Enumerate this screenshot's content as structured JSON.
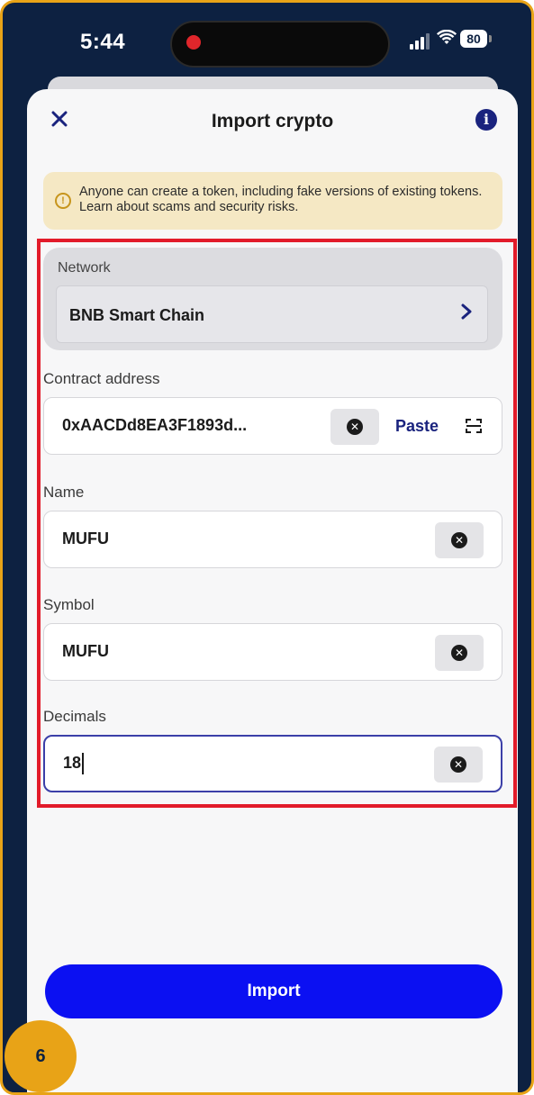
{
  "status_bar": {
    "time": "5:44",
    "battery": "80"
  },
  "header": {
    "title": "Import crypto"
  },
  "warning": {
    "text": "Anyone can create a token, including fake versions of existing tokens. Learn about scams and security risks."
  },
  "network": {
    "label": "Network",
    "value": "BNB Smart Chain"
  },
  "contract": {
    "label": "Contract address",
    "value": "0xAACDd8EA3F1893d...",
    "paste_label": "Paste"
  },
  "name_field": {
    "label": "Name",
    "value": "MUFU"
  },
  "symbol_field": {
    "label": "Symbol",
    "value": "MUFU"
  },
  "decimals_field": {
    "label": "Decimals",
    "value": "18"
  },
  "actions": {
    "import_label": "Import"
  },
  "step_badge": "6",
  "colors": {
    "accent": "#1a237e",
    "primary_button": "#0b10f2",
    "highlight": "#e21b2a",
    "badge": "#e8a317",
    "frame": "#0d2141"
  }
}
